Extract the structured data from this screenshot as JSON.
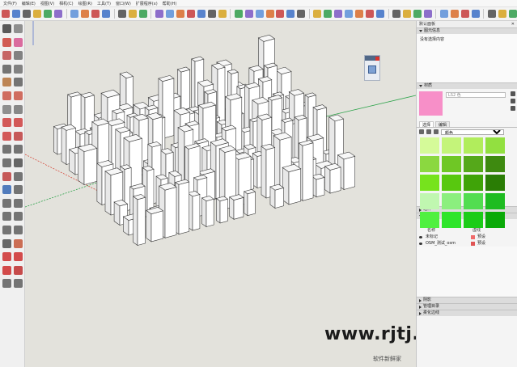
{
  "menu": [
    "文件(F)",
    "编辑(E)",
    "视图(V)",
    "相机(C)",
    "绘图(R)",
    "工具(T)",
    "窗口(W)",
    "扩展程序(x)",
    "帮助(H)"
  ],
  "toolbar_icons": [
    "new-icon",
    "open-icon",
    "save-icon",
    "cut-icon",
    "copy-icon",
    "paste-icon",
    "erase-icon",
    "undo-icon",
    "redo-icon",
    "print-icon",
    "model-info-icon",
    "warehouse-icon",
    "share-icon",
    "extension-icon",
    "iso-view-icon",
    "top-view-icon",
    "front-view-icon",
    "right-view-icon",
    "back-view-icon",
    "left-view-icon",
    "bottom-view-icon",
    "xray-icon",
    "back-edges-icon",
    "wireframe-icon",
    "hidden-line-icon",
    "shaded-icon",
    "textured-icon",
    "monochrome-icon",
    "orbit-icon",
    "pan-icon",
    "zoom-icon",
    "zoom-window-icon",
    "zoom-extents-icon",
    "previous-view-icon",
    "position-camera-icon",
    "walk-icon",
    "look-around-icon",
    "section-plane-icon",
    "box-view-icon",
    "style-a-icon",
    "style-b-icon",
    "style-c-icon",
    "style-d-icon",
    "solid-tools-icon",
    "outer-shell-icon"
  ],
  "viewport": {
    "watermark": "www.rjtj.cn软荐网",
    "footer_label": "软件新鲜家"
  },
  "tray": {
    "title": "默认面板",
    "entity_info": {
      "label": "图元信息",
      "empty": "没有选择内容"
    },
    "materials": {
      "label": "材质",
      "name_placeholder": "LS2 色",
      "swatch_color": "#f78fc8",
      "tabs": [
        "选择",
        "编辑"
      ],
      "collection": "颜色",
      "swatches": [
        "#d5fa99",
        "#c4f47a",
        "#b1ed5c",
        "#92e040",
        "#8bd840",
        "#6fc725",
        "#55a81a",
        "#3e8a10",
        "#76e31d",
        "#58c80f",
        "#3fa308",
        "#2a7d05",
        "#c0f7b0",
        "#8bef7e",
        "#52dd50",
        "#1ebc21",
        "#50f040",
        "#2ee52a",
        "#1ccc18",
        "#0aaa08"
      ]
    },
    "sections": [
      "组件",
      "标记"
    ],
    "tags": {
      "header_name": "名称",
      "header_linetype": "虚线",
      "rows": [
        {
          "name": "未标记",
          "color": "#f06a6a",
          "linetype": "预设"
        },
        {
          "name": "OSM_测试_osm",
          "color": "#e05555",
          "linetype": "预设"
        }
      ]
    },
    "bottom_sections": [
      "阴影",
      "管理目录",
      "柔化边线"
    ]
  },
  "colors": {
    "axis_green": "#2ca34a",
    "axis_red": "#d53a2b",
    "building_fill": "#ffffff",
    "building_edge": "#3a3a3a"
  }
}
